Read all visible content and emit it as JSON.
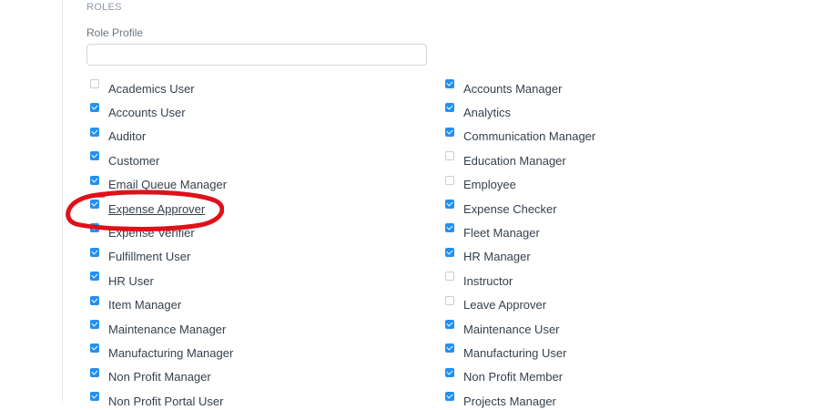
{
  "section": {
    "title": "ROLES"
  },
  "role_profile": {
    "label": "Role Profile",
    "value": "",
    "placeholder": ""
  },
  "roles_left": [
    {
      "label": "Academics User",
      "checked": false
    },
    {
      "label": "Accounts User",
      "checked": true
    },
    {
      "label": "Auditor",
      "checked": true
    },
    {
      "label": "Customer",
      "checked": true
    },
    {
      "label": "Email Queue Manager",
      "checked": true
    },
    {
      "label": "Expense Approver",
      "checked": true
    },
    {
      "label": "Expense Verifier",
      "checked": true
    },
    {
      "label": "Fulfillment User",
      "checked": true
    },
    {
      "label": "HR User",
      "checked": true
    },
    {
      "label": "Item Manager",
      "checked": true
    },
    {
      "label": "Maintenance Manager",
      "checked": true
    },
    {
      "label": "Manufacturing Manager",
      "checked": true
    },
    {
      "label": "Non Profit Manager",
      "checked": true
    },
    {
      "label": "Non Profit Portal User",
      "checked": true
    }
  ],
  "roles_right": [
    {
      "label": "Accounts Manager",
      "checked": true
    },
    {
      "label": "Analytics",
      "checked": true
    },
    {
      "label": "Communication Manager",
      "checked": true
    },
    {
      "label": "Education Manager",
      "checked": false
    },
    {
      "label": "Employee",
      "checked": false
    },
    {
      "label": "Expense Checker",
      "checked": true
    },
    {
      "label": "Fleet Manager",
      "checked": true
    },
    {
      "label": "HR Manager",
      "checked": true
    },
    {
      "label": "Instructor",
      "checked": false
    },
    {
      "label": "Leave Approver",
      "checked": false
    },
    {
      "label": "Maintenance User",
      "checked": true
    },
    {
      "label": "Manufacturing User",
      "checked": true
    },
    {
      "label": "Non Profit Member",
      "checked": true
    },
    {
      "label": "Projects Manager",
      "checked": true
    }
  ],
  "annotation": {
    "color": "#e0101b"
  },
  "colors": {
    "accent": "#2490ef"
  }
}
